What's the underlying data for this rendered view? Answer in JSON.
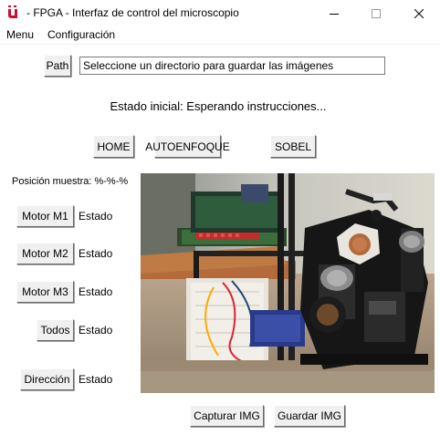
{
  "window": {
    "title": " - FPGA - Interfaz de control del microscopio",
    "controls": {
      "minimize": "minimize-icon",
      "maximize": "maximize-icon",
      "close": "close-icon"
    }
  },
  "menu": {
    "items": [
      "Menu",
      "Configuración"
    ]
  },
  "path": {
    "button_label": "Path",
    "entry_value": "Seleccione un directorio para guardar las imágenes"
  },
  "status": {
    "text": "Estado inicial: Esperando instrucciones..."
  },
  "actions": {
    "home": "HOME",
    "autofocus": "AUTOENFOQUE",
    "sobel": "SOBEL"
  },
  "position": {
    "label": "Posición muestra: %-%-%"
  },
  "motors": [
    {
      "button": "Motor M1",
      "state": "Estado"
    },
    {
      "button": "Motor M2",
      "state": "Estado"
    },
    {
      "button": "Motor M3",
      "state": "Estado"
    },
    {
      "button": "Todos",
      "state": "Estado"
    },
    {
      "button": "Dirección",
      "state": "Estado"
    }
  ],
  "camera": {
    "image_alt": "Microscope rig with FPGA board and motors"
  },
  "capture": {
    "capture_label": "Capturar IMG",
    "save_label": "Guardar IMG"
  },
  "colors": {
    "window_bg": "#ffffff",
    "button_bg": "#f0f0f0",
    "icon_red": "#c8102e"
  }
}
